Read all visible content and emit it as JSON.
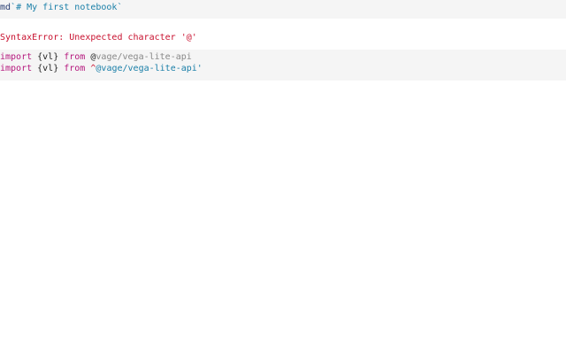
{
  "notebook": {
    "md_cell": {
      "tag": "md",
      "content": "`# My first notebook`"
    },
    "error_cell": {
      "message": "SyntaxError: Unexpected character '@'"
    },
    "code_cell": {
      "line1": {
        "kw_import": "import",
        "binding": " {vl} ",
        "kw_from": "from",
        "space": " ",
        "at": "@",
        "rest": "vage/vega-lite-api"
      },
      "line2": {
        "kw_import": "import",
        "binding": " {vl} ",
        "kw_from": "from",
        "space": " ",
        "caret": "^",
        "string": "@vage/vega-lite-api'"
      }
    }
  },
  "colors": {
    "keyword": "#b5187d",
    "string": "#1a7fa8",
    "error": "#c8102e",
    "cell_bg": "#f5f5f5"
  }
}
